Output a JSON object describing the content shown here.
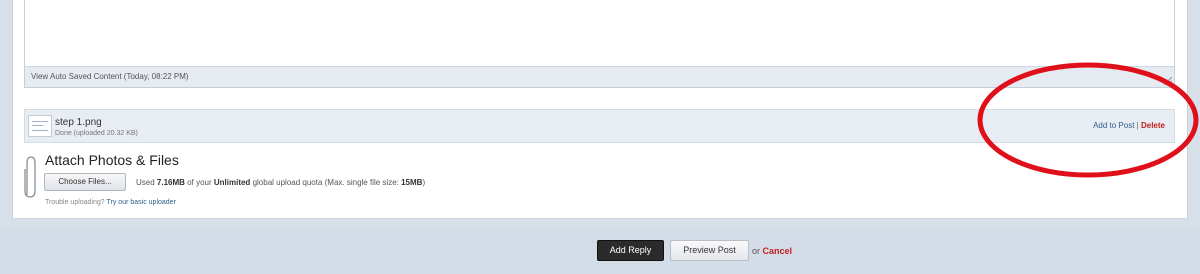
{
  "editor": {
    "autosave_text": "View Auto Saved Content (Today, 08:22 PM)"
  },
  "attachment": {
    "filename": "step 1.png",
    "status": "Done (uploaded 20.32 KB)",
    "add_to_post": "Add to Post",
    "separator": "|",
    "delete": "Delete"
  },
  "attach": {
    "title": "Attach Photos & Files",
    "choose_button": "Choose Files...",
    "quota_prefix": "Used",
    "quota_used": "7.16MB",
    "quota_mid": "of your",
    "quota_type": "Unlimited",
    "quota_suffix": "global upload quota (Max. single file size:",
    "max_size": "15MB",
    "quota_end": ")",
    "trouble_text": "Trouble uploading?",
    "trouble_link": "Try our basic uploader"
  },
  "footer": {
    "add_reply": "Add Reply",
    "preview_post": "Preview Post",
    "or": "or",
    "cancel": "Cancel"
  },
  "colors": {
    "annotation": "#e0101a",
    "delete": "#c02020",
    "link": "#2f5f8f"
  }
}
